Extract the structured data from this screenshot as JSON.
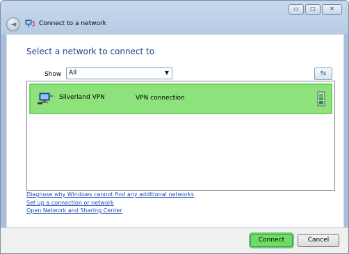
{
  "window": {
    "title": "Connect to a network",
    "controls": {
      "minimize": "▭",
      "maximize": "□",
      "close": "✕"
    },
    "back_glyph": "◄"
  },
  "main": {
    "heading": "Select a network to connect to",
    "show_label": "Show",
    "show_value": "All",
    "refresh_glyph": "⇆"
  },
  "networks": [
    {
      "name": "Silverland VPN",
      "type": "VPN connection",
      "selected": true
    }
  ],
  "links": [
    "Diagnose why Windows cannot find any additional networks",
    "Set up a connection or network",
    "Open Network and Sharing Center"
  ],
  "footer": {
    "connect_label": "Connect",
    "cancel_label": "Cancel"
  },
  "colors": {
    "highlight": "#8ee27b",
    "heading": "#1e3e8c",
    "link": "#1f4bb8"
  },
  "icons": [
    "back-arrow-icon",
    "network-title-icon",
    "refresh-icon",
    "vpn-network-icon",
    "signal-strength-icon",
    "dropdown-arrow-icon"
  ]
}
